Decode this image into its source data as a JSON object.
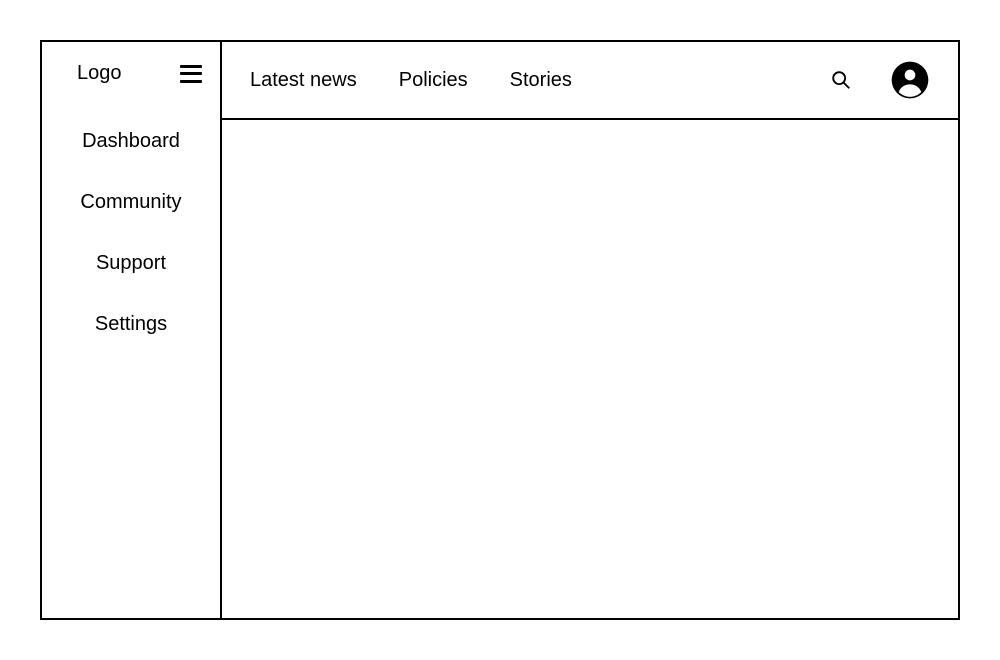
{
  "sidebar": {
    "logo_label": "Logo",
    "items": [
      {
        "label": "Dashboard"
      },
      {
        "label": "Community"
      },
      {
        "label": "Support"
      },
      {
        "label": "Settings"
      }
    ]
  },
  "topbar": {
    "tabs": [
      {
        "label": "Latest news"
      },
      {
        "label": "Policies"
      },
      {
        "label": "Stories"
      }
    ]
  }
}
